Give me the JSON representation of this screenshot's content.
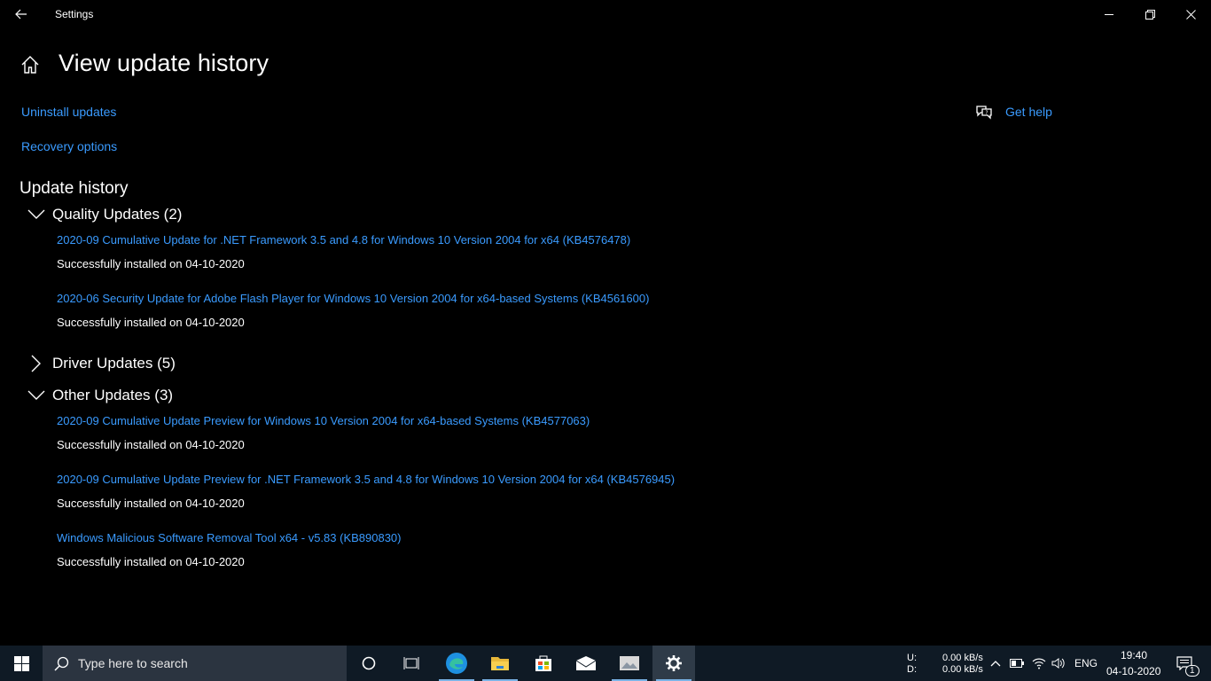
{
  "window": {
    "title": "Settings"
  },
  "page": {
    "title": "View update history",
    "links": {
      "uninstall": "Uninstall updates",
      "recovery": "Recovery options"
    },
    "help": "Get help",
    "section_title": "Update history"
  },
  "groups": [
    {
      "label": "Quality Updates (2)",
      "expanded": true
    },
    {
      "label": "Driver Updates (5)",
      "expanded": false
    },
    {
      "label": "Other Updates (3)",
      "expanded": true
    }
  ],
  "updates": [
    {
      "title": "2020-09 Cumulative Update for .NET Framework 3.5 and 4.8 for Windows 10 Version 2004 for x64 (KB4576478)",
      "status": "Successfully installed on 04-10-2020"
    },
    {
      "title": "2020-06 Security Update for Adobe Flash Player for Windows 10 Version 2004 for x64-based Systems (KB4561600)",
      "status": "Successfully installed on 04-10-2020"
    },
    {
      "title": "2020-09 Cumulative Update Preview for Windows 10 Version 2004 for x64-based Systems (KB4577063)",
      "status": "Successfully installed on 04-10-2020"
    },
    {
      "title": "2020-09 Cumulative Update Preview for .NET Framework 3.5 and 4.8 for Windows 10 Version 2004 for x64 (KB4576945)",
      "status": "Successfully installed on 04-10-2020"
    },
    {
      "title": "Windows Malicious Software Removal Tool x64 - v5.83 (KB890830)",
      "status": "Successfully installed on 04-10-2020"
    }
  ],
  "taskbar": {
    "search_placeholder": "Type here to search",
    "net_up_label": "U:",
    "net_down_label": "D:",
    "net_up": "0.00 kB/s",
    "net_down": "0.00 kB/s",
    "language": "ENG",
    "time": "19:40",
    "date": "04-10-2020",
    "notification_count": "1",
    "apps": [
      "start-icon",
      "cortana-icon",
      "task-view-icon",
      "edge-icon",
      "file-explorer-icon",
      "store-icon",
      "mail-icon",
      "photos-icon",
      "settings-icon"
    ]
  },
  "colors": {
    "link": "#3a9bff",
    "background": "#000000",
    "taskbar": "#0f1a25"
  }
}
